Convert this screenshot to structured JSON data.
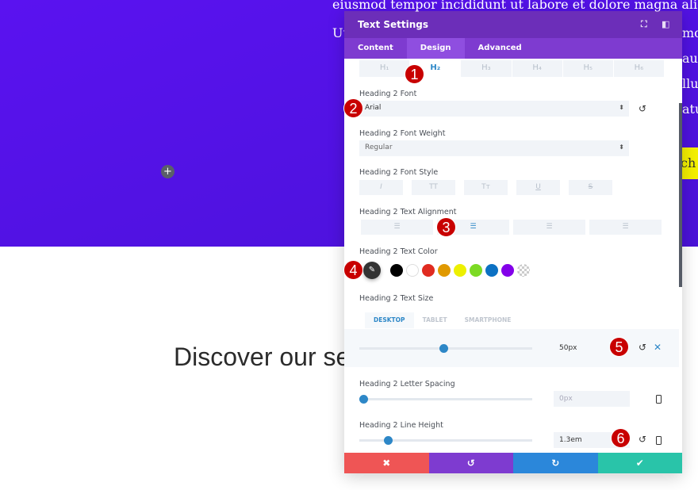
{
  "background": {
    "text_lines": [
      "eiusmod tempor incididunt ut labore et dolore magna aliqu",
      "Ut",
      "mo",
      "au",
      "llu",
      "atu"
    ],
    "button_fragment": "ch",
    "heading_fragment": "Discover our se",
    "add_icon": "plus-icon"
  },
  "panel": {
    "title": "Text Settings",
    "tabs": [
      "Content",
      "Design",
      "Advanced"
    ],
    "active_tab": "Design",
    "heading_tabs": [
      "H₁",
      "H₂",
      "H₃",
      "H₄",
      "H₅",
      "H₆"
    ],
    "font_label": "Heading 2 Font",
    "font_value": "Arial",
    "weight_label": "Heading 2 Font Weight",
    "weight_value": "Regular",
    "style_label": "Heading 2 Font Style",
    "style_buttons": [
      "I",
      "TT",
      "Tт",
      "U",
      "S"
    ],
    "align_label": "Heading 2 Text Alignment",
    "align_icons": [
      "align-left-icon",
      "align-center-icon",
      "align-right-icon",
      "align-justify-icon"
    ],
    "color_label": "Heading 2 Text Color",
    "colors": [
      "#000000",
      "#ffffff",
      "#e02b20",
      "#e09900",
      "#edf000",
      "#7cda24",
      "#0c71c3",
      "#8300e9",
      "transparent"
    ],
    "size_label": "Heading 2 Text Size",
    "device_tabs": [
      "DESKTOP",
      "TABLET",
      "SMARTPHONE"
    ],
    "size_value": "50px",
    "size_percent": 49,
    "spacing_label": "Heading 2 Letter Spacing",
    "spacing_value": "0px",
    "spacing_percent": 0,
    "lh_label": "Heading 2 Line Height",
    "lh_value": "1.3em",
    "lh_percent": 15,
    "footer": [
      "✖",
      "↺",
      "↻",
      "✔"
    ],
    "footer_colors": [
      "#ef5555",
      "#7e3bd0",
      "#2b87da",
      "#29c4a9"
    ]
  },
  "badges": [
    "1",
    "2",
    "3",
    "4",
    "5",
    "6"
  ],
  "colors": {
    "hero": "#5412e8",
    "header": "#6c2eb9",
    "tabs": "#7e3bd0",
    "accent": "#2d87c7",
    "badge": "#c80000"
  }
}
